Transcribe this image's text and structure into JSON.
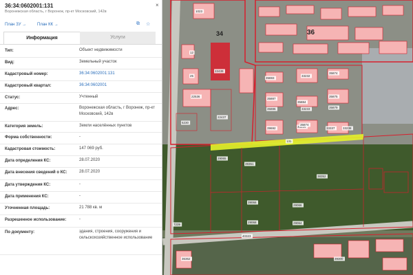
{
  "header": {
    "cadastral_number": "36:34:0602001:131",
    "address_short": "Воронежская область, г Воронеж, пр-кт Московский, 142в",
    "close_label": "×"
  },
  "toolbar": {
    "plan_zu": "План ЗУ →",
    "plan_kk": "План КК →"
  },
  "tabs": [
    {
      "label": "Информация",
      "active": true
    },
    {
      "label": "Услуги",
      "active": false
    }
  ],
  "info_rows": [
    {
      "label": "Тип:",
      "value": "Объект недвижимости"
    },
    {
      "label": "Вид:",
      "value": "Земельный участок"
    },
    {
      "label": "Кадастровый номер:",
      "value": "36:34:0602001:131",
      "link": true
    },
    {
      "label": "Кадастровый квартал:",
      "value": "36:34:0602001",
      "link": true
    },
    {
      "label": "Статус:",
      "value": "Учтенный"
    },
    {
      "label": "Адрес:",
      "value": "Воронежская область, г Воронеж, пр-кт Московский, 142в"
    },
    {
      "label": "Категория земель:",
      "value": "Земли населённых пунктов"
    },
    {
      "label": "Форма собственности:",
      "value": "-"
    },
    {
      "label": "Кадастровая стоимость:",
      "value": "147 069 руб."
    },
    {
      "label": "Дата определения КС:",
      "value": "28.07.2020"
    },
    {
      "label": "Дата внесения сведений о КС:",
      "value": "28.07.2020"
    },
    {
      "label": "Дата утверждения КС:",
      "value": "-"
    },
    {
      "label": "Дата применения КС:",
      "value": "-"
    },
    {
      "label": "Уточненная площадь:",
      "value": "21 788 кв. м"
    },
    {
      "label": "Разрешенное использование:",
      "value": "-"
    },
    {
      "label": "По документу:",
      "value": "здания, строения, сооружения и сельскохозяйственное использование"
    }
  ],
  "map": {
    "quarter_labels": [
      "34",
      "36"
    ],
    "parcel_labels": [
      "1023",
      "22439",
      "12",
      "25",
      "22536",
      "5230",
      "22437",
      "35883",
      "33232",
      "35874",
      "35887",
      "35886",
      "35884",
      "35875",
      "33233",
      "35879",
      "39692",
      "33226",
      "35874",
      "33337",
      "33238",
      "131",
      "29065",
      "39351",
      "38352",
      "39066",
      "29066",
      "29068",
      "7239",
      "40323",
      "29064",
      "36362",
      "39300"
    ],
    "colors": {
      "parcel_fill": "#f6b4b4",
      "parcel_border": "#d81e2c",
      "highlight": "#e3f22a",
      "forest": "#3f5a2c",
      "road": "#c8c8c0"
    }
  }
}
